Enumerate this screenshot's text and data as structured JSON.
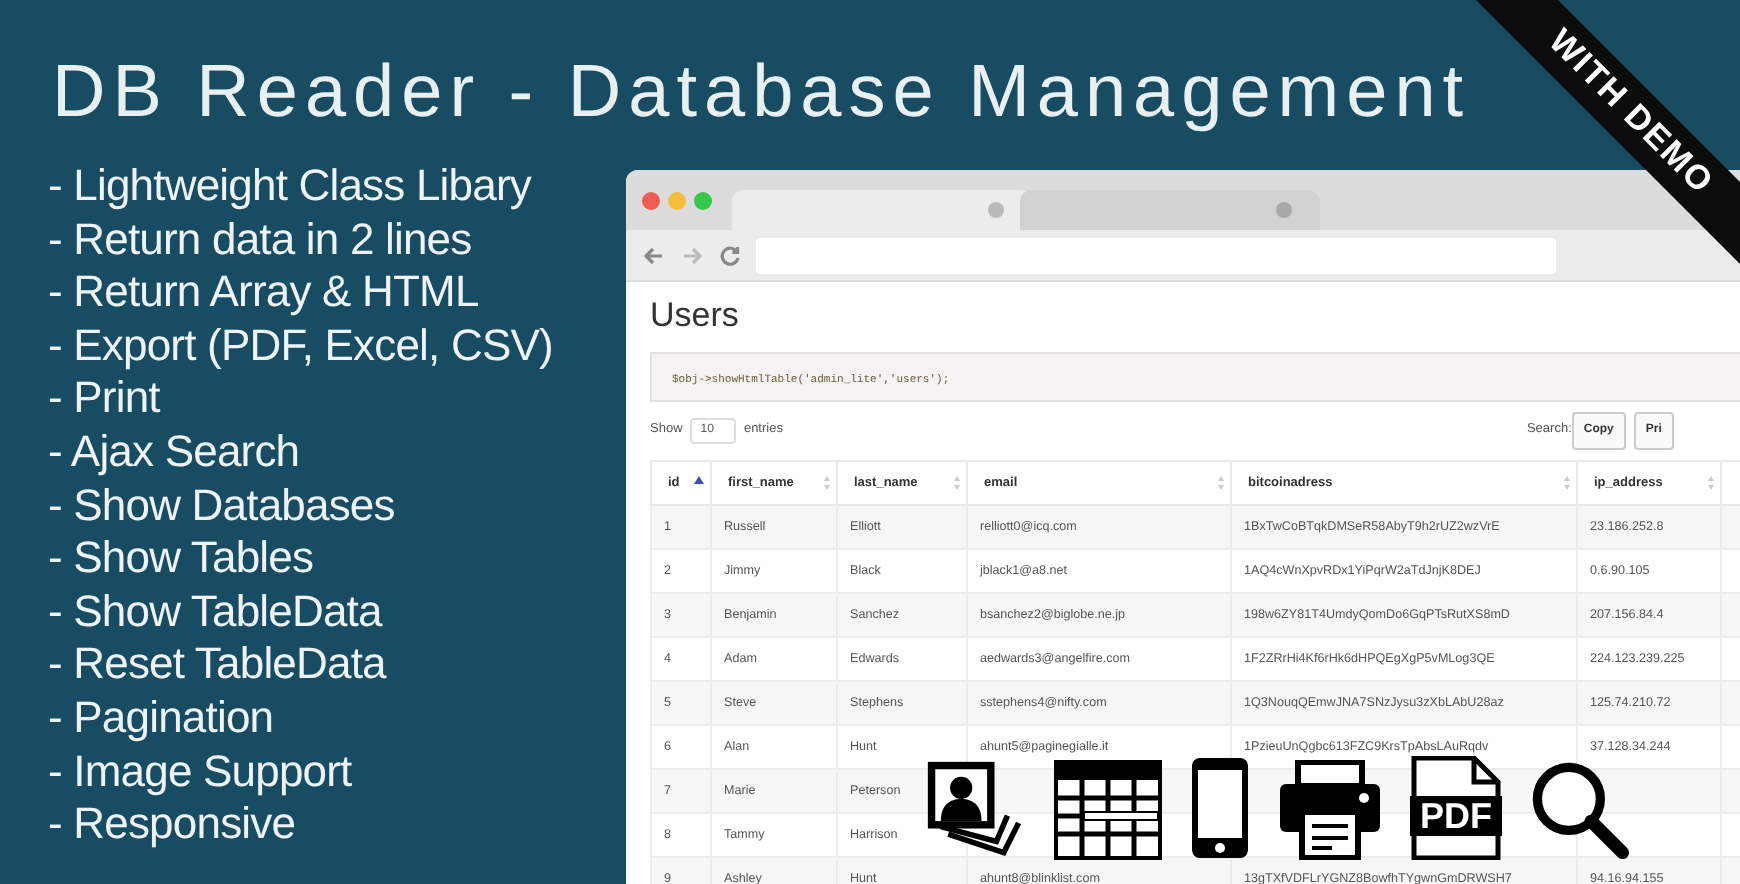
{
  "title": "DB Reader - Database Management",
  "ribbon": "WITH DEMO",
  "features": [
    "- Lightweight Class Libary",
    "- Return data in 2 lines",
    "- Return Array & HTML",
    "- Export (PDF, Excel, CSV)",
    "- Print",
    "- Ajax Search",
    "- Show Databases",
    "- Show Tables",
    "- Show TableData",
    "- Reset TableData",
    "- Pagination",
    "- Image Support",
    "- Responsive"
  ],
  "browser": {
    "tabs": [
      {
        "selected": true
      },
      {
        "selected": false
      }
    ],
    "page_title": "Users",
    "code": "$obj->showHtmlTable('admin_lite','users');",
    "show_label": "Show",
    "page_size": "10",
    "entries_label": "entries",
    "search_label": "Search:",
    "buttons": [
      "Copy",
      "Pri"
    ],
    "table": {
      "columns": [
        {
          "label": "id",
          "sorted": true
        },
        {
          "label": "first_name",
          "sorted": false
        },
        {
          "label": "last_name",
          "sorted": false
        },
        {
          "label": "email",
          "sorted": false
        },
        {
          "label": "bitcoinadress",
          "sorted": false
        },
        {
          "label": "ip_address",
          "sorted": false
        }
      ],
      "rows": [
        {
          "cells": [
            "1",
            "Russell",
            "Elliott",
            "relliott0@icq.com",
            "1BxTwCoBTqkDMSeR58AbyT9h2rUZ2wzVrE",
            "23.186.252.8"
          ]
        },
        {
          "cells": [
            "2",
            "Jimmy",
            "Black",
            "jblack1@a8.net",
            "1AQ4cWnXpvRDx1YiPqrW2aTdJnjK8DEJ",
            "0.6.90.105"
          ]
        },
        {
          "cells": [
            "3",
            "Benjamin",
            "Sanchez",
            "bsanchez2@biglobe.ne.jp",
            "198w6ZY81T4UmdyQomDo6GqPTsRutXS8mD",
            "207.156.84.4"
          ]
        },
        {
          "cells": [
            "4",
            "Adam",
            "Edwards",
            "aedwards3@angelfire.com",
            "1F2ZRrHi4Kf6rHk6dHPQEgXgP5vMLog3QE",
            "224.123.239.225"
          ]
        },
        {
          "cells": [
            "5",
            "Steve",
            "Stephens",
            "sstephens4@nifty.com",
            "1Q3NouqQEmwJNA7SNzJysu3zXbLAbU28az",
            "125.74.210.72"
          ]
        },
        {
          "cells": [
            "6",
            "Alan",
            "Hunt",
            "ahunt5@paginegialle.it",
            "1PzieuUnQgbc613FZC9KrsTpAbsLAuRqdv",
            "37.128.34.244"
          ]
        },
        {
          "cells": [
            "7",
            "Marie",
            "Peterson"
          ]
        },
        {
          "cells": [
            "8",
            "Tammy",
            "Harrison"
          ]
        },
        {
          "cells": [
            "9",
            "Ashley",
            "Hunt",
            "ahunt8@blinklist.com",
            "13gTXfVDFLrYGNZ8BowfhTYgwnGmDRWSH7",
            "94.16.94.155"
          ]
        }
      ]
    }
  },
  "icons": [
    {
      "kind": "photos"
    },
    {
      "kind": "table"
    },
    {
      "kind": "phone"
    },
    {
      "kind": "printer"
    },
    {
      "kind": "pdf",
      "label": "PDF"
    },
    {
      "kind": "search"
    }
  ]
}
